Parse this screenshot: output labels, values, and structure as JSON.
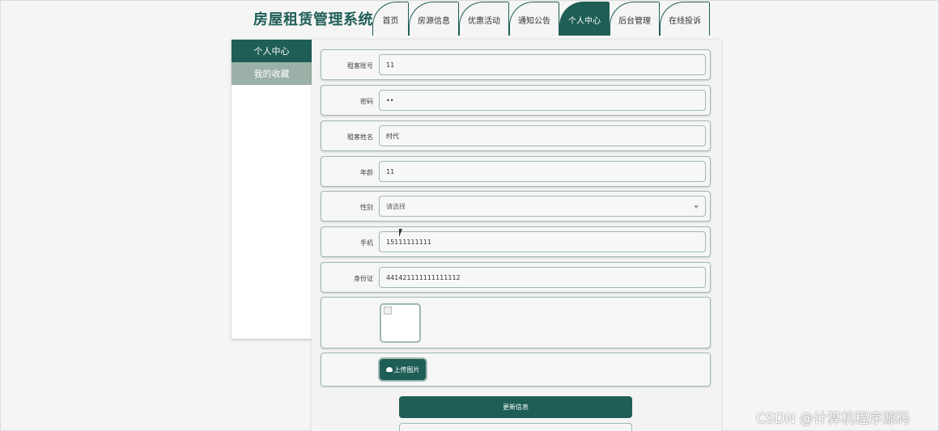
{
  "header": {
    "site_title": "房屋租赁管理系统",
    "nav": [
      {
        "label": "首页",
        "active": false
      },
      {
        "label": "房源信息",
        "active": false
      },
      {
        "label": "优惠活动",
        "active": false
      },
      {
        "label": "通知公告",
        "active": false
      },
      {
        "label": "个人中心",
        "active": true
      },
      {
        "label": "后台管理",
        "active": false
      },
      {
        "label": "在线投诉",
        "active": false
      }
    ]
  },
  "sidebar": {
    "items": [
      {
        "label": "个人中心",
        "active": true
      },
      {
        "label": "我的收藏",
        "active": false
      }
    ]
  },
  "form": {
    "fields": [
      {
        "label": "租客账号",
        "value": "11"
      },
      {
        "label": "密码",
        "value": "••"
      },
      {
        "label": "租客姓名",
        "value": "时代"
      },
      {
        "label": "年龄",
        "value": "11"
      },
      {
        "label": "性别",
        "value": "请选择"
      },
      {
        "label": "手机",
        "value": "15111111111"
      },
      {
        "label": "身份证",
        "value": "441421111111111112"
      }
    ],
    "upload_label": "上传图片",
    "update_label": "更新信息"
  },
  "watermark": "CSDN @计算机程序源码",
  "colors": {
    "accent": "#1f5e56",
    "sidebar_secondary": "#9bb0a6",
    "border": "#9fb8b1"
  }
}
